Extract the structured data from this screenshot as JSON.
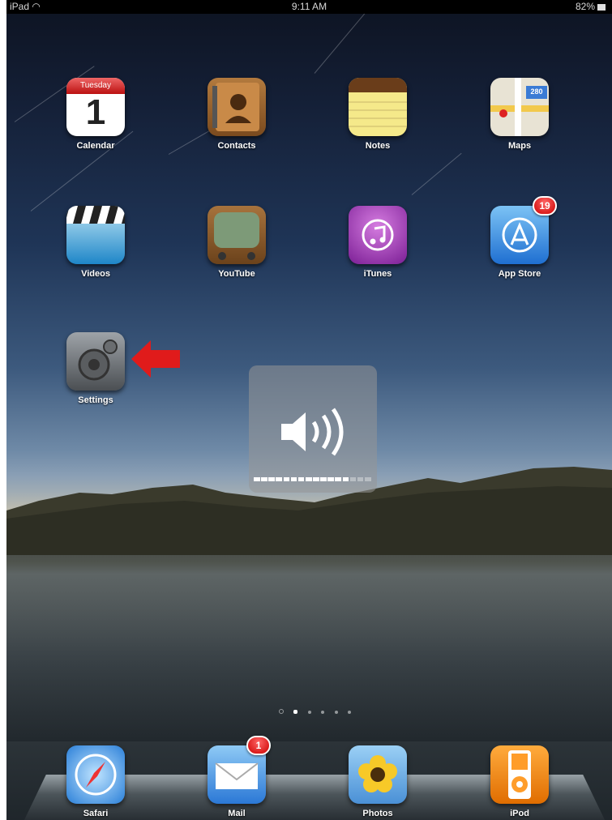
{
  "status_bar": {
    "device": "iPad",
    "time": "9:11 AM",
    "battery": "82%"
  },
  "home_grid": [
    {
      "id": "calendar",
      "label": "Calendar",
      "icon": "calendar-icon",
      "calendar_day": "Tuesday",
      "calendar_date": "1"
    },
    {
      "id": "contacts",
      "label": "Contacts",
      "icon": "contacts-icon"
    },
    {
      "id": "notes",
      "label": "Notes",
      "icon": "notes-icon"
    },
    {
      "id": "maps",
      "label": "Maps",
      "icon": "maps-icon",
      "route_number": "280"
    },
    {
      "id": "videos",
      "label": "Videos",
      "icon": "videos-icon"
    },
    {
      "id": "youtube",
      "label": "YouTube",
      "icon": "youtube-icon"
    },
    {
      "id": "itunes",
      "label": "iTunes",
      "icon": "itunes-icon"
    },
    {
      "id": "appstore",
      "label": "App Store",
      "icon": "app-store-icon",
      "badge": "19"
    },
    {
      "id": "settings",
      "label": "Settings",
      "icon": "settings-icon"
    }
  ],
  "dock": [
    {
      "id": "safari",
      "label": "Safari",
      "icon": "safari-icon"
    },
    {
      "id": "mail",
      "label": "Mail",
      "icon": "mail-icon",
      "badge": "1"
    },
    {
      "id": "photos",
      "label": "Photos",
      "icon": "photos-icon"
    },
    {
      "id": "ipod",
      "label": "iPod",
      "icon": "ipod-icon"
    }
  ],
  "volume_hud": {
    "icon": "speaker-icon",
    "level_fraction": 0.8,
    "segments": 16
  },
  "page_indicator": {
    "pages": 6,
    "current": 1
  },
  "annotation": {
    "color": "#e01b1b",
    "icon": "red-arrow-icon"
  },
  "colors": {
    "badge": "#d00000",
    "label": "#ffffff"
  }
}
